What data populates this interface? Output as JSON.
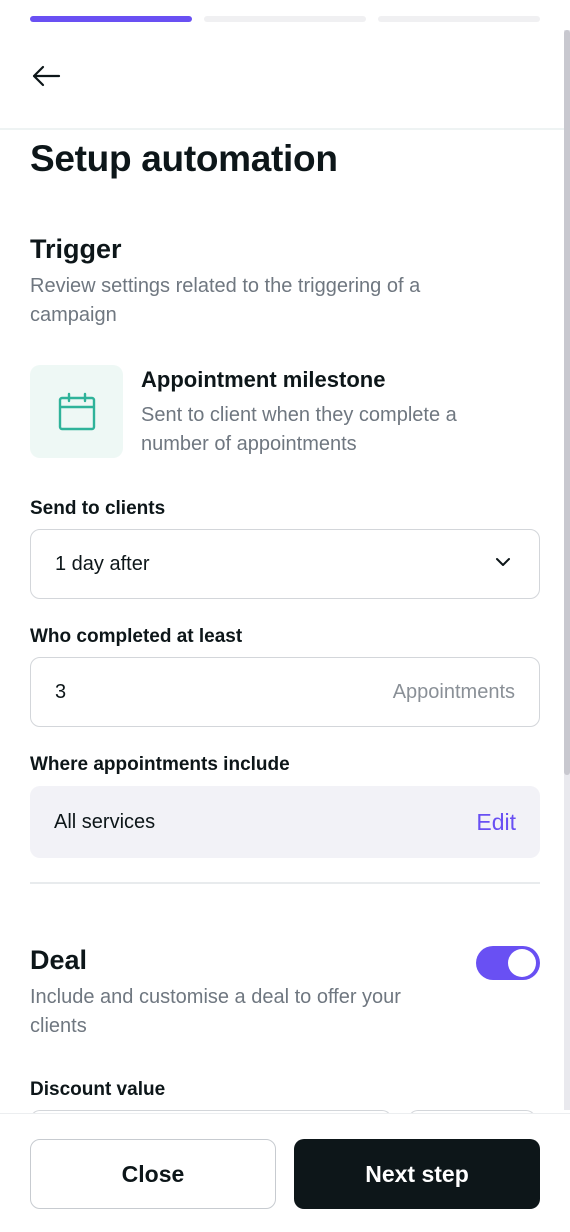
{
  "progress": {
    "total_steps": 3,
    "current_step": 1
  },
  "header": {
    "title": "Setup automation"
  },
  "trigger": {
    "title": "Trigger",
    "description": "Review settings related to the triggering of a campaign",
    "card": {
      "icon": "calendar-icon",
      "title": "Appointment milestone",
      "description": "Sent to client when they complete a number of appointments"
    }
  },
  "send_to_clients": {
    "label": "Send to clients",
    "value": "1 day after"
  },
  "completed": {
    "label": "Who completed at least",
    "value": "3",
    "suffix": "Appointments"
  },
  "appointments_include": {
    "label": "Where appointments include",
    "value": "All services",
    "edit_label": "Edit"
  },
  "deal": {
    "title": "Deal",
    "description": "Include and customise a deal to offer your clients",
    "enabled": true
  },
  "discount": {
    "label": "Discount value"
  },
  "footer": {
    "close_label": "Close",
    "next_label": "Next step"
  },
  "colors": {
    "accent": "#6950f3",
    "primary_button": "#0d1619",
    "icon_bg": "#eef8f5",
    "icon_stroke": "#2fb39a"
  }
}
